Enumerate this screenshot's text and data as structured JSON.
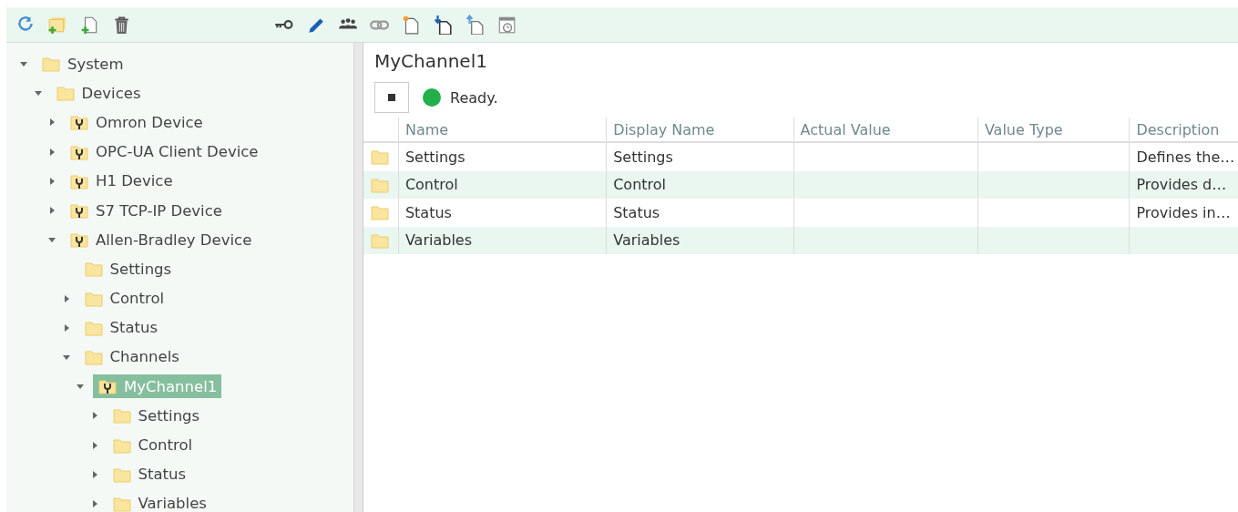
{
  "toolbar": {
    "left": [
      {
        "kind": "refresh"
      },
      {
        "kind": "add-folder"
      },
      {
        "kind": "add-file"
      },
      {
        "kind": "delete"
      }
    ],
    "right": [
      {
        "kind": "key"
      },
      {
        "kind": "edit"
      },
      {
        "kind": "users"
      },
      {
        "kind": "link"
      },
      {
        "kind": "new-doc"
      },
      {
        "kind": "import"
      },
      {
        "kind": "export"
      },
      {
        "kind": "schedule"
      }
    ]
  },
  "tree": [
    {
      "label": "System",
      "kind": "folder",
      "expandable": true,
      "expanded": true,
      "selected": false,
      "children": [
        {
          "label": "Devices",
          "kind": "folder",
          "expandable": true,
          "expanded": true,
          "selected": false,
          "children": [
            {
              "label": "Omron Device",
              "kind": "device",
              "expandable": true,
              "expanded": false,
              "selected": false
            },
            {
              "label": "OPC-UA Client Device",
              "kind": "device",
              "expandable": true,
              "expanded": false,
              "selected": false
            },
            {
              "label": "H1 Device",
              "kind": "device",
              "expandable": true,
              "expanded": false,
              "selected": false
            },
            {
              "label": "S7 TCP-IP Device",
              "kind": "device",
              "expandable": true,
              "expanded": false,
              "selected": false
            },
            {
              "label": "Allen-Bradley Device",
              "kind": "device",
              "expandable": true,
              "expanded": true,
              "selected": false,
              "children": [
                {
                  "label": "Settings",
                  "kind": "folder",
                  "expandable": false,
                  "selected": false
                },
                {
                  "label": "Control",
                  "kind": "folder",
                  "expandable": true,
                  "expanded": false,
                  "selected": false
                },
                {
                  "label": "Status",
                  "kind": "folder",
                  "expandable": true,
                  "expanded": false,
                  "selected": false
                },
                {
                  "label": "Channels",
                  "kind": "folder",
                  "expandable": true,
                  "expanded": true,
                  "selected": false,
                  "children": [
                    {
                      "label": "MyChannel1",
                      "kind": "device",
                      "expandable": true,
                      "expanded": true,
                      "selected": true,
                      "children": [
                        {
                          "label": "Settings",
                          "kind": "folder",
                          "expandable": true,
                          "expanded": false,
                          "selected": false
                        },
                        {
                          "label": "Control",
                          "kind": "folder",
                          "expandable": true,
                          "expanded": false,
                          "selected": false
                        },
                        {
                          "label": "Status",
                          "kind": "folder",
                          "expandable": true,
                          "expanded": false,
                          "selected": false
                        },
                        {
                          "label": "Variables",
                          "kind": "folder",
                          "expandable": true,
                          "expanded": false,
                          "selected": false
                        }
                      ]
                    }
                  ]
                }
              ]
            }
          ]
        }
      ]
    }
  ],
  "detail": {
    "title": "MyChannel1",
    "status": {
      "text": "Ready.",
      "color": "#22b04b"
    },
    "table": {
      "columns": [
        "Name",
        "Display Name",
        "Actual Value",
        "Value Type",
        "Description"
      ],
      "rows": [
        {
          "cells": [
            "Settings",
            "Settings",
            "",
            "",
            "Defines the…"
          ]
        },
        {
          "cells": [
            "Control",
            "Control",
            "",
            "",
            "Provides d…"
          ]
        },
        {
          "cells": [
            "Status",
            "Status",
            "",
            "",
            "Provides in…"
          ]
        },
        {
          "cells": [
            "Variables",
            "Variables",
            "",
            "",
            ""
          ]
        }
      ]
    }
  }
}
